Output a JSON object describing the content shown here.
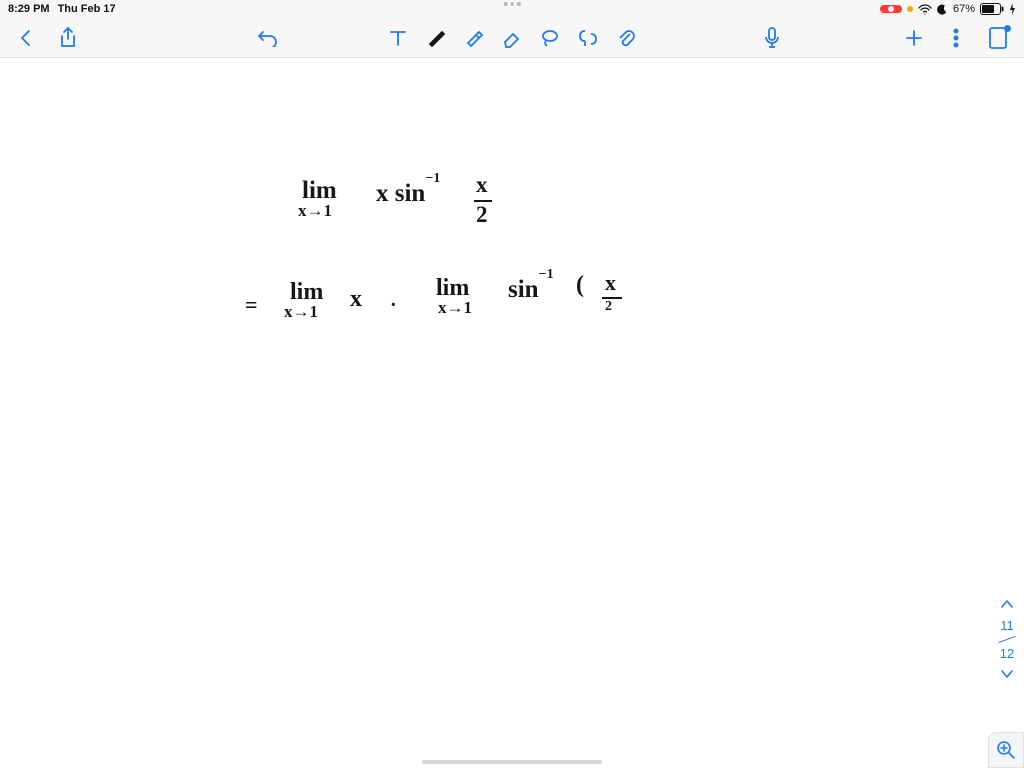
{
  "status": {
    "time": "8:29 PM",
    "date": "Thu Feb 17",
    "battery_pct": "67%"
  },
  "toolbar": {
    "icons": {
      "back": "back-chevron",
      "share": "share",
      "undo": "undo",
      "text": "text-tool",
      "pen": "pen-tool",
      "highlighter": "highlighter-tool",
      "eraser": "eraser-tool",
      "lasso": "lasso-tool",
      "scissors": "cut-tool",
      "link": "link-tool",
      "mic": "microphone",
      "add": "add",
      "more": "more",
      "pages": "pages"
    }
  },
  "handwriting": {
    "line1_lim": "lim",
    "line1_sub": "x→1",
    "line1_expr": "x sin",
    "line1_sup": "−1",
    "line1_frac_top": "x",
    "line1_frac_bot": "2",
    "eq": "=",
    "line2a_lim": "lim",
    "line2a_sub": "x→1",
    "line2a_x": "x",
    "dot": "·",
    "line2b_lim": "lim",
    "line2b_sub": "x→1",
    "line2b_sin": "sin",
    "line2b_sup": "−1",
    "line2b_paren": "(",
    "line2b_frac_top": "x",
    "line2b_frac_bot": "2"
  },
  "pagenav": {
    "current": "11",
    "total": "12"
  }
}
